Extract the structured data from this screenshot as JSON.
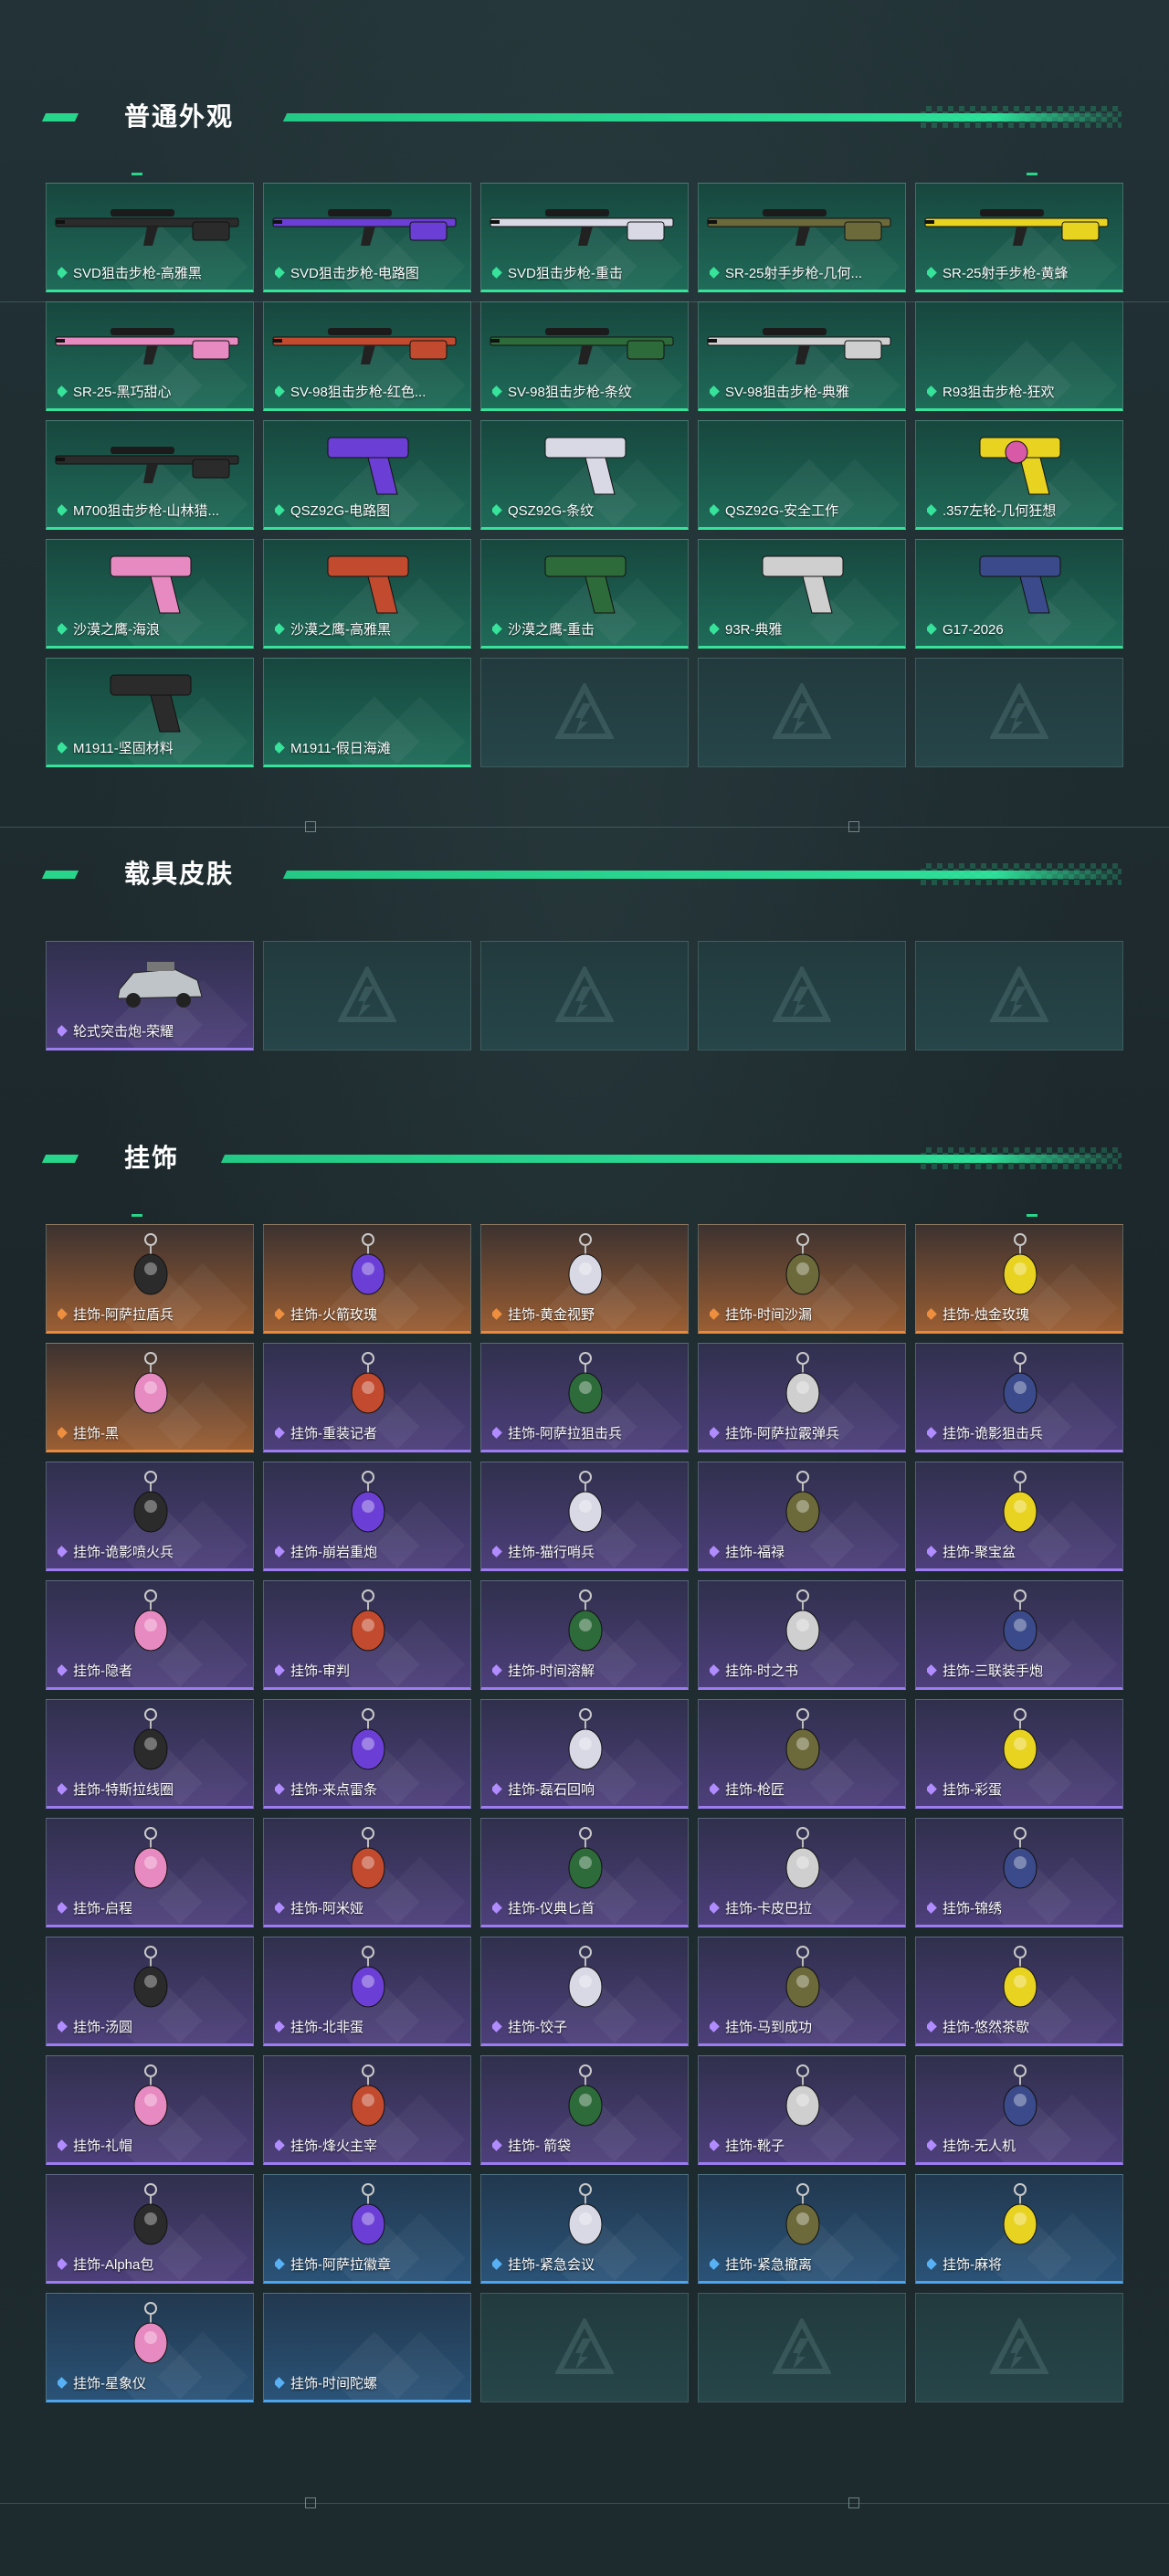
{
  "colors": {
    "accent": "#27d68a",
    "rarity_green": "#37e39a",
    "rarity_gold": "#e58a3e",
    "rarity_purple": "#9c7cf0",
    "rarity_blue": "#4da3ec"
  },
  "sections": {
    "weapons": {
      "title": "普通外观",
      "items": [
        {
          "label": "SVD狙击步枪-高雅黑",
          "icon": "sniper-rifle-icon",
          "rarity": "green"
        },
        {
          "label": "SVD狙击步枪-电路图",
          "icon": "sniper-rifle-icon",
          "rarity": "green"
        },
        {
          "label": "SVD狙击步枪-重击",
          "icon": "sniper-rifle-icon",
          "rarity": "green"
        },
        {
          "label": "SR-25射手步枪-几何...",
          "icon": "rifle-icon",
          "rarity": "green"
        },
        {
          "label": "SR-25射手步枪-黄蜂",
          "icon": "rifle-icon",
          "rarity": "green"
        },
        {
          "label": "SR-25-黑巧甜心",
          "icon": "rifle-icon",
          "rarity": "green"
        },
        {
          "label": "SV-98狙击步枪-红色...",
          "icon": "sniper-rifle-icon",
          "rarity": "green"
        },
        {
          "label": "SV-98狙击步枪-条纹",
          "icon": "sniper-rifle-icon",
          "rarity": "green"
        },
        {
          "label": "SV-98狙击步枪-典雅",
          "icon": "sniper-rifle-icon",
          "rarity": "green"
        },
        {
          "label": "R93狙击步枪-狂欢",
          "icon": "",
          "rarity": "green"
        },
        {
          "label": "M700狙击步枪-山林猎...",
          "icon": "sniper-rifle-icon",
          "rarity": "green"
        },
        {
          "label": "QSZ92G-电路图",
          "icon": "pistol-icon",
          "rarity": "green"
        },
        {
          "label": "QSZ92G-条纹",
          "icon": "pistol-icon",
          "rarity": "green"
        },
        {
          "label": "QSZ92G-安全工作",
          "icon": "",
          "rarity": "green"
        },
        {
          "label": ".357左轮-几何狂想",
          "icon": "revolver-icon",
          "rarity": "green"
        },
        {
          "label": "沙漠之鹰-海浪",
          "icon": "pistol-icon",
          "rarity": "green"
        },
        {
          "label": "沙漠之鹰-高雅黑",
          "icon": "pistol-icon",
          "rarity": "green"
        },
        {
          "label": "沙漠之鹰-重击",
          "icon": "pistol-icon",
          "rarity": "green"
        },
        {
          "label": "93R-典雅",
          "icon": "pistol-icon",
          "rarity": "green"
        },
        {
          "label": "G17-2026",
          "icon": "pistol-icon",
          "rarity": "green"
        },
        {
          "label": "M1911-坚固材料",
          "icon": "pistol-icon",
          "rarity": "green"
        },
        {
          "label": "M1911-假日海滩",
          "icon": "",
          "rarity": "green"
        },
        {
          "label": "",
          "icon": "",
          "rarity": "empty"
        },
        {
          "label": "",
          "icon": "",
          "rarity": "empty"
        },
        {
          "label": "",
          "icon": "",
          "rarity": "empty"
        }
      ]
    },
    "vehicles": {
      "title": "载具皮肤",
      "items": [
        {
          "label": "轮式突击炮-荣耀",
          "icon": "vehicle-icon",
          "rarity": "purple"
        },
        {
          "label": "",
          "icon": "",
          "rarity": "empty"
        },
        {
          "label": "",
          "icon": "",
          "rarity": "empty"
        },
        {
          "label": "",
          "icon": "",
          "rarity": "empty"
        },
        {
          "label": "",
          "icon": "",
          "rarity": "empty"
        }
      ]
    },
    "charms": {
      "title": "挂饰",
      "items": [
        {
          "label": "挂饰-阿萨拉盾兵",
          "icon": "charm-icon",
          "rarity": "gold"
        },
        {
          "label": "挂饰-火箭玫瑰",
          "icon": "charm-icon",
          "rarity": "gold"
        },
        {
          "label": "挂饰-黄金视野",
          "icon": "charm-icon",
          "rarity": "gold"
        },
        {
          "label": "挂饰-时间沙漏",
          "icon": "charm-icon",
          "rarity": "gold"
        },
        {
          "label": "挂饰-烛金玫瑰",
          "icon": "charm-icon",
          "rarity": "gold"
        },
        {
          "label": "挂饰-黑",
          "icon": "charm-icon",
          "rarity": "gold"
        },
        {
          "label": "挂饰-重装记者",
          "icon": "charm-icon",
          "rarity": "purple"
        },
        {
          "label": "挂饰-阿萨拉狙击兵",
          "icon": "charm-icon",
          "rarity": "purple"
        },
        {
          "label": "挂饰-阿萨拉霰弹兵",
          "icon": "charm-icon",
          "rarity": "purple"
        },
        {
          "label": "挂饰-诡影狙击兵",
          "icon": "charm-icon",
          "rarity": "purple"
        },
        {
          "label": "挂饰-诡影喷火兵",
          "icon": "charm-icon",
          "rarity": "purple"
        },
        {
          "label": "挂饰-崩岩重炮",
          "icon": "charm-icon",
          "rarity": "purple"
        },
        {
          "label": "挂饰-猫行哨兵",
          "icon": "charm-icon",
          "rarity": "purple"
        },
        {
          "label": "挂饰-福禄",
          "icon": "charm-icon",
          "rarity": "purple"
        },
        {
          "label": "挂饰-聚宝盆",
          "icon": "charm-icon",
          "rarity": "purple"
        },
        {
          "label": "挂饰-隐者",
          "icon": "charm-icon",
          "rarity": "purple"
        },
        {
          "label": "挂饰-审判",
          "icon": "charm-icon",
          "rarity": "purple"
        },
        {
          "label": "挂饰-时间溶解",
          "icon": "charm-icon",
          "rarity": "purple"
        },
        {
          "label": "挂饰-时之书",
          "icon": "charm-icon",
          "rarity": "purple"
        },
        {
          "label": "挂饰-三联装手炮",
          "icon": "charm-icon",
          "rarity": "purple"
        },
        {
          "label": "挂饰-特斯拉线圈",
          "icon": "charm-icon",
          "rarity": "purple"
        },
        {
          "label": "挂饰-来点雷条",
          "icon": "charm-icon",
          "rarity": "purple"
        },
        {
          "label": "挂饰-磊石回响",
          "icon": "charm-icon",
          "rarity": "purple"
        },
        {
          "label": "挂饰-枪匠",
          "icon": "charm-icon",
          "rarity": "purple"
        },
        {
          "label": "挂饰-彩蛋",
          "icon": "charm-icon",
          "rarity": "purple"
        },
        {
          "label": "挂饰-启程",
          "icon": "charm-icon",
          "rarity": "purple"
        },
        {
          "label": "挂饰-阿米娅",
          "icon": "charm-icon",
          "rarity": "purple"
        },
        {
          "label": "挂饰-仪典匕首",
          "icon": "charm-icon",
          "rarity": "purple"
        },
        {
          "label": "挂饰-卡皮巴拉",
          "icon": "charm-icon",
          "rarity": "purple"
        },
        {
          "label": "挂饰-锦绣",
          "icon": "charm-icon",
          "rarity": "purple"
        },
        {
          "label": "挂饰-汤圆",
          "icon": "charm-icon",
          "rarity": "purple"
        },
        {
          "label": "挂饰-北非蛋",
          "icon": "charm-icon",
          "rarity": "purple"
        },
        {
          "label": "挂饰-饺子",
          "icon": "charm-icon",
          "rarity": "purple"
        },
        {
          "label": "挂饰-马到成功",
          "icon": "charm-icon",
          "rarity": "purple"
        },
        {
          "label": "挂饰-悠然茶歇",
          "icon": "charm-icon",
          "rarity": "purple"
        },
        {
          "label": "挂饰-礼帽",
          "icon": "charm-icon",
          "rarity": "purple"
        },
        {
          "label": "挂饰-烽火主宰",
          "icon": "charm-icon",
          "rarity": "purple"
        },
        {
          "label": "挂饰- 箭袋",
          "icon": "charm-icon",
          "rarity": "purple"
        },
        {
          "label": "挂饰-靴子",
          "icon": "charm-icon",
          "rarity": "purple"
        },
        {
          "label": "挂饰-无人机",
          "icon": "charm-icon",
          "rarity": "purple"
        },
        {
          "label": "挂饰-Alpha包",
          "icon": "charm-icon",
          "rarity": "purple"
        },
        {
          "label": "挂饰-阿萨拉徽章",
          "icon": "charm-icon",
          "rarity": "blue"
        },
        {
          "label": "挂饰-紧急会议",
          "icon": "charm-icon",
          "rarity": "blue"
        },
        {
          "label": "挂饰-紧急撤离",
          "icon": "charm-icon",
          "rarity": "blue"
        },
        {
          "label": "挂饰-麻将",
          "icon": "charm-icon",
          "rarity": "blue"
        },
        {
          "label": "挂饰-星象仪",
          "icon": "charm-icon",
          "rarity": "blue"
        },
        {
          "label": "挂饰-时间陀螺",
          "icon": "",
          "rarity": "blue"
        },
        {
          "label": "",
          "icon": "",
          "rarity": "empty"
        },
        {
          "label": "",
          "icon": "",
          "rarity": "empty"
        },
        {
          "label": "",
          "icon": "",
          "rarity": "empty"
        }
      ]
    }
  }
}
